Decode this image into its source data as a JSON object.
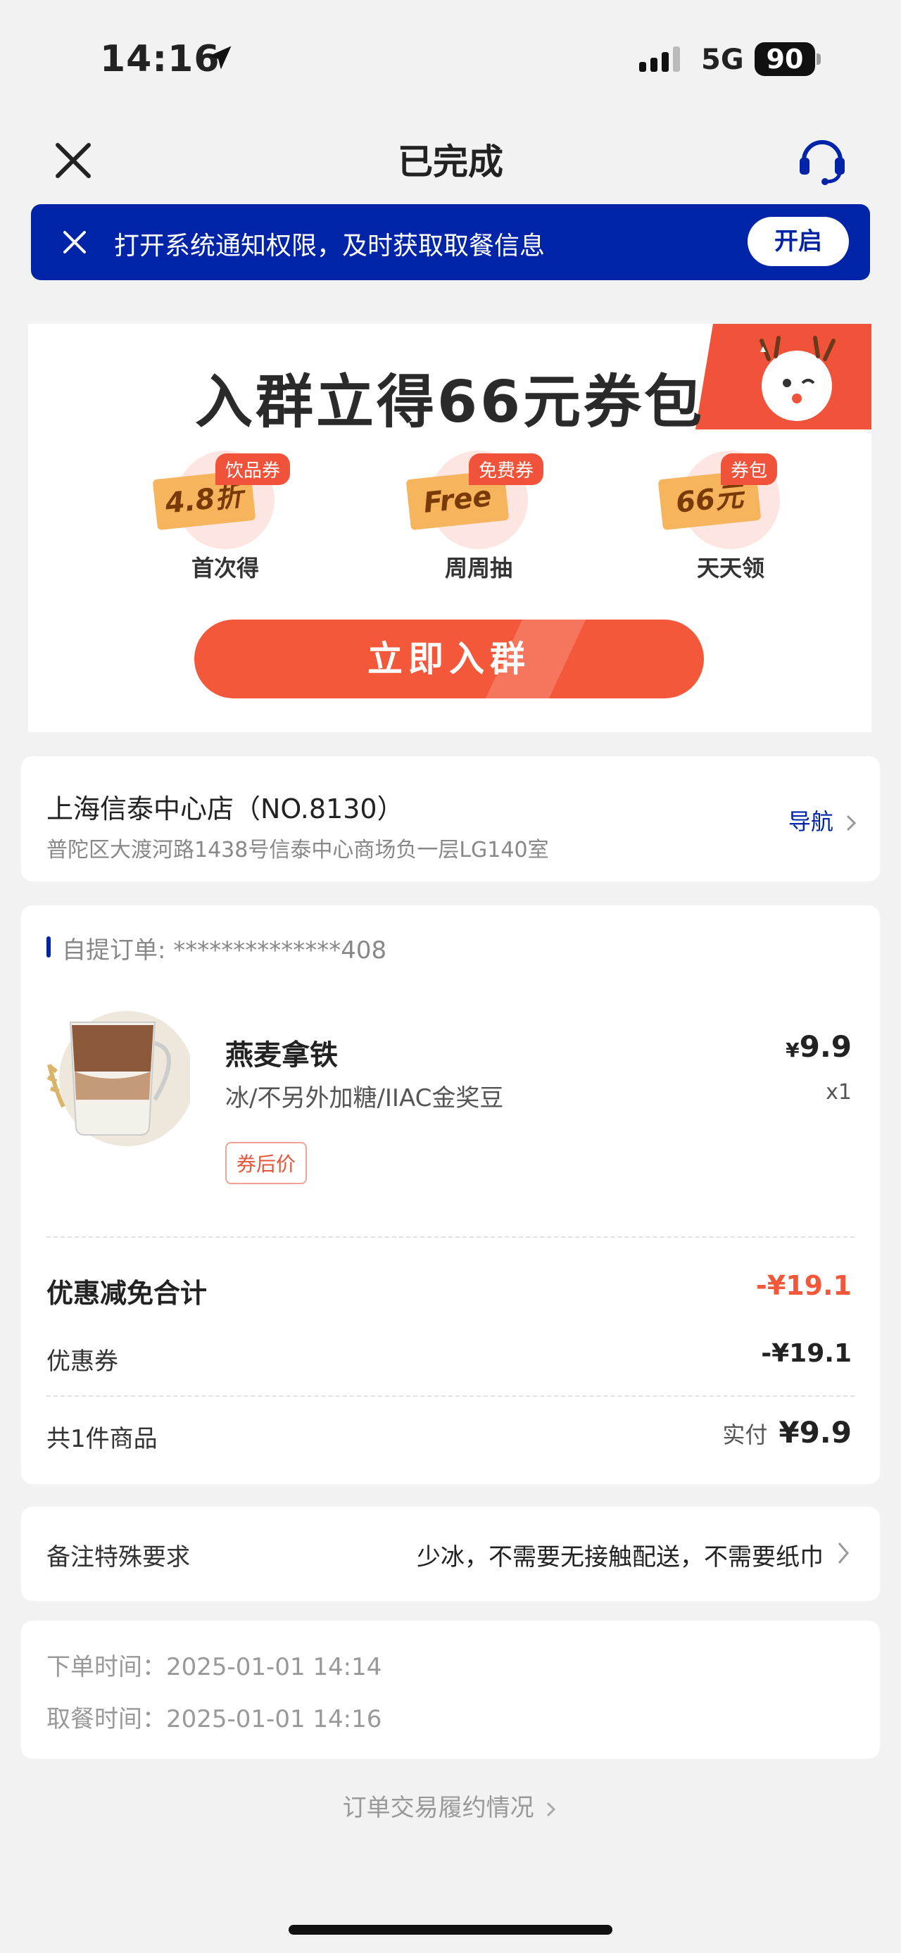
{
  "status_bar": {
    "time": "14:16",
    "network": "5G",
    "battery": "90"
  },
  "header": {
    "title": "已完成"
  },
  "banner": {
    "text": "打开系统通知权限，及时获取取餐信息",
    "button": "开启"
  },
  "promo": {
    "title": "入群立得66元券包",
    "coupons": [
      {
        "tag": "饮品券",
        "ticket": "4.8折",
        "label": "首次得"
      },
      {
        "tag": "免费券",
        "ticket": "Free",
        "label": "周周抽"
      },
      {
        "tag": "券包",
        "ticket": "66元",
        "label": "天天领"
      }
    ],
    "button": "立即入群"
  },
  "store": {
    "name": "上海信泰中心店（NO.8130）",
    "address": "普陀区大渡河路1438号信泰中心商场负一层LG140室",
    "nav": "导航"
  },
  "order": {
    "label": "自提订单: **************408",
    "product": {
      "name": "燕麦拿铁",
      "options": "冰/不另外加糖/IIAC金奖豆",
      "badge": "券后价",
      "price": "9.9",
      "currency": "¥",
      "qty": "x1"
    },
    "discount_total_label": "优惠减免合计",
    "discount_total_value": "-¥19.1",
    "coupon_label": "优惠券",
    "coupon_value": "-¥19.1",
    "count_label": "共1件商品",
    "paid_label": "实付",
    "paid_value": "¥9.9"
  },
  "remark": {
    "label": "备注特殊要求",
    "value": "少冰，不需要无接触配送，不需要纸巾"
  },
  "times": {
    "order_time": "下单时间：2025-01-01 14:14",
    "pickup_time": "取餐时间：2025-01-01 14:16"
  },
  "footer": {
    "link": "订单交易履约情况"
  },
  "colors": {
    "brand_blue": "#0024a8",
    "accent_red": "#f4583a",
    "background": "#f2f2f2"
  }
}
